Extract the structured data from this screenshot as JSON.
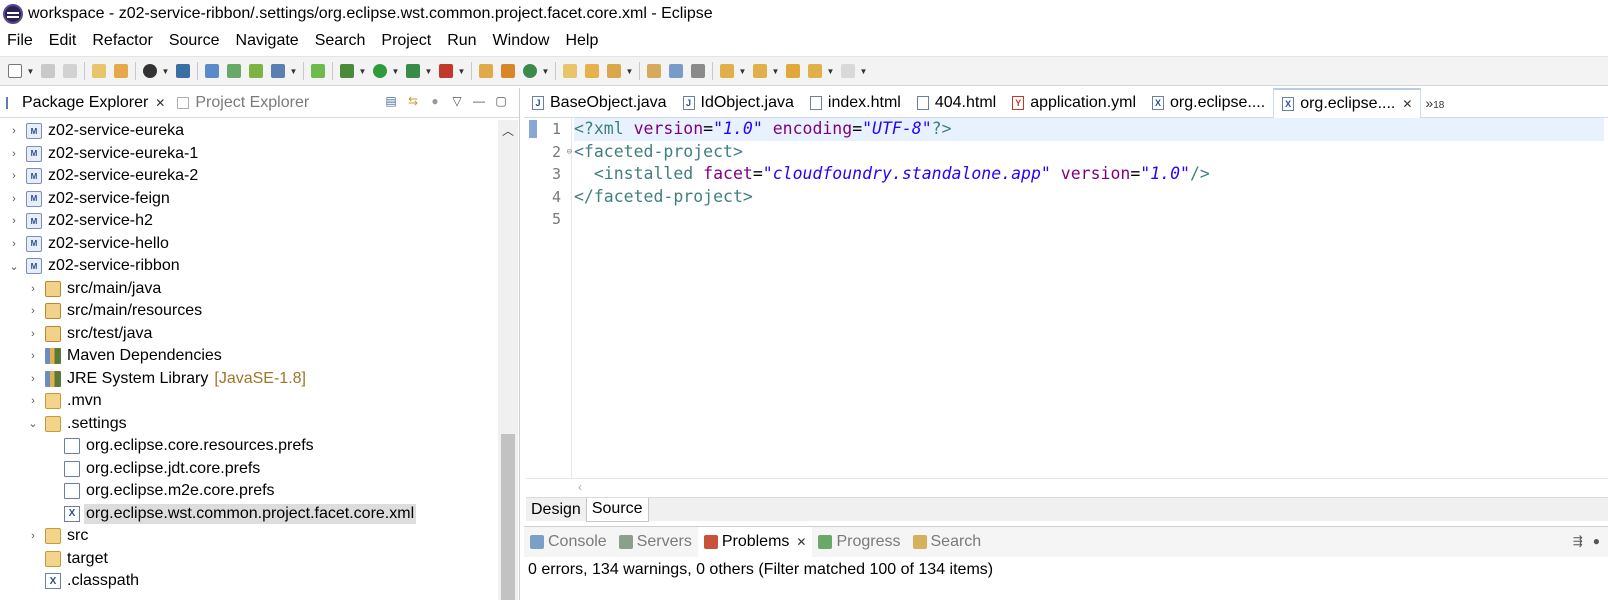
{
  "window": {
    "title": "workspace - z02-service-ribbon/.settings/org.eclipse.wst.common.project.facet.core.xml - Eclipse"
  },
  "menu": [
    "File",
    "Edit",
    "Refactor",
    "Source",
    "Navigate",
    "Search",
    "Project",
    "Run",
    "Window",
    "Help"
  ],
  "left_panel": {
    "tabs": [
      {
        "label": "Package Explorer",
        "active": true
      },
      {
        "label": "Project Explorer",
        "active": false
      }
    ],
    "tree": [
      {
        "label": "z02-service-eureka",
        "indent": 0,
        "twisty": ">",
        "icon": "project-icon"
      },
      {
        "label": "z02-service-eureka-1",
        "indent": 0,
        "twisty": ">",
        "icon": "project-icon"
      },
      {
        "label": "z02-service-eureka-2",
        "indent": 0,
        "twisty": ">",
        "icon": "project-icon"
      },
      {
        "label": "z02-service-feign",
        "indent": 0,
        "twisty": ">",
        "icon": "project-icon"
      },
      {
        "label": "z02-service-h2",
        "indent": 0,
        "twisty": ">",
        "icon": "project-icon"
      },
      {
        "label": "z02-service-hello",
        "indent": 0,
        "twisty": ">",
        "icon": "project-icon"
      },
      {
        "label": "z02-service-ribbon",
        "indent": 0,
        "twisty": "v",
        "icon": "project-icon"
      },
      {
        "label": "src/main/java",
        "indent": 1,
        "twisty": ">",
        "icon": "package-root-icon"
      },
      {
        "label": "src/main/resources",
        "indent": 1,
        "twisty": ">",
        "icon": "package-root-icon"
      },
      {
        "label": "src/test/java",
        "indent": 1,
        "twisty": ">",
        "icon": "package-root-icon"
      },
      {
        "label": "Maven Dependencies",
        "indent": 1,
        "twisty": ">",
        "icon": "library-icon"
      },
      {
        "label": "JRE System Library",
        "decor": "[JavaSE-1.8]",
        "indent": 1,
        "twisty": ">",
        "icon": "library-icon"
      },
      {
        "label": ".mvn",
        "indent": 1,
        "twisty": ">",
        "icon": "folder-icon"
      },
      {
        "label": ".settings",
        "indent": 1,
        "twisty": "v",
        "icon": "folder-icon"
      },
      {
        "label": "org.eclipse.core.resources.prefs",
        "indent": 2,
        "twisty": "",
        "icon": "file-icon"
      },
      {
        "label": "org.eclipse.jdt.core.prefs",
        "indent": 2,
        "twisty": "",
        "icon": "file-icon"
      },
      {
        "label": "org.eclipse.m2e.core.prefs",
        "indent": 2,
        "twisty": "",
        "icon": "file-icon"
      },
      {
        "label": "org.eclipse.wst.common.project.facet.core.xml",
        "indent": 2,
        "twisty": "",
        "icon": "xml-file-icon",
        "selected": true
      },
      {
        "label": "src",
        "indent": 1,
        "twisty": ">",
        "icon": "folder-icon"
      },
      {
        "label": "target",
        "indent": 1,
        "twisty": "",
        "icon": "folder-icon"
      },
      {
        "label": ".classpath",
        "indent": 1,
        "twisty": "",
        "icon": "xml-file-icon"
      }
    ]
  },
  "editor_tabs": [
    {
      "label": "BaseObject.java",
      "icon": "J",
      "active": false
    },
    {
      "label": "IdObject.java",
      "icon": "J",
      "active": false
    },
    {
      "label": "index.html",
      "icon": "",
      "active": false
    },
    {
      "label": "404.html",
      "icon": "",
      "active": false
    },
    {
      "label": "application.yml",
      "icon": "Y",
      "active": false
    },
    {
      "label": "org.eclipse....",
      "icon": "X",
      "active": false
    },
    {
      "label": "org.eclipse....",
      "icon": "X",
      "active": true
    }
  ],
  "more_tabs": {
    "glyph": "»",
    "count": "18"
  },
  "editor": {
    "line_numbers": [
      "1",
      "2",
      "3",
      "4",
      "5"
    ],
    "lines": [
      [
        {
          "t": "<?xml ",
          "c": "tag"
        },
        {
          "t": "version",
          "c": "attr"
        },
        {
          "t": "=",
          "c": "eq"
        },
        {
          "t": "\"1.0\"",
          "c": "str"
        },
        {
          "t": " ",
          "c": "eq"
        },
        {
          "t": "encoding",
          "c": "attr"
        },
        {
          "t": "=",
          "c": "eq"
        },
        {
          "t": "\"UTF-8\"",
          "c": "str"
        },
        {
          "t": "?>",
          "c": "tag"
        }
      ],
      [
        {
          "t": "<faceted-project>",
          "c": "tag"
        }
      ],
      [
        {
          "t": "  ",
          "c": "eq"
        },
        {
          "t": "<installed ",
          "c": "tag"
        },
        {
          "t": "facet",
          "c": "attr"
        },
        {
          "t": "=",
          "c": "eq"
        },
        {
          "t": "\"cloudfoundry.standalone.app\"",
          "c": "str"
        },
        {
          "t": " ",
          "c": "eq"
        },
        {
          "t": "version",
          "c": "attr"
        },
        {
          "t": "=",
          "c": "eq"
        },
        {
          "t": "\"1.0\"",
          "c": "str"
        },
        {
          "t": "/>",
          "c": "tag"
        }
      ],
      [
        {
          "t": "</faceted-project>",
          "c": "tag"
        }
      ],
      []
    ]
  },
  "design_tabs": [
    {
      "label": "Design",
      "active": false
    },
    {
      "label": "Source",
      "active": true
    }
  ],
  "bottom_tabs": [
    {
      "label": "Console",
      "active": false,
      "icon_color": "#7aa0c8"
    },
    {
      "label": "Servers",
      "active": false,
      "icon_color": "#8aa08a"
    },
    {
      "label": "Problems",
      "active": true,
      "icon_color": "#c8533a"
    },
    {
      "label": "Progress",
      "active": false,
      "icon_color": "#6aa86a"
    },
    {
      "label": "Search",
      "active": false,
      "icon_color": "#d6b15c"
    }
  ],
  "problems": {
    "summary": "0 errors, 134 warnings, 0 others (Filter matched 100 of 134 items)"
  },
  "colors": {
    "xml_tag": "#3f7f7f",
    "xml_attr": "#7f007f",
    "xml_string": "#2a00ff",
    "current_line": "#e8f2fe",
    "selection": "#dddddd"
  }
}
